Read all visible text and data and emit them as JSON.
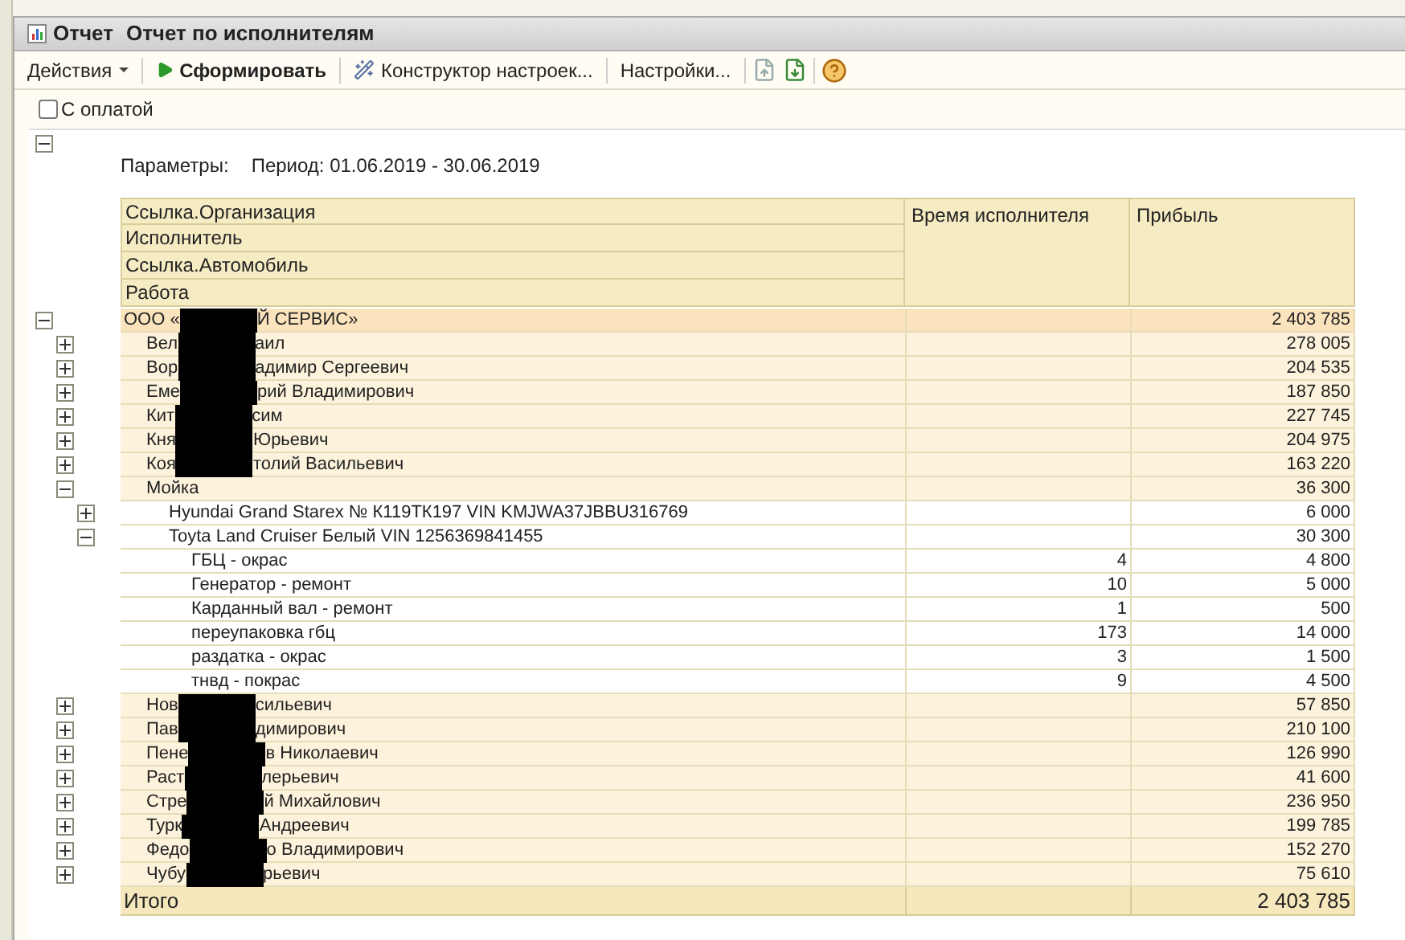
{
  "window": {
    "kind_label": "Отчет",
    "title": "Отчет по исполнителям"
  },
  "toolbar": {
    "actions_menu": "Действия",
    "generate": "Сформировать",
    "designer": "Конструктор настроек...",
    "settings": "Настройки..."
  },
  "filter": {
    "label": "С оплатой",
    "checked": false
  },
  "report": {
    "parameters_label": "Параметры:",
    "period": "Период: 01.06.2019 - 30.06.2019",
    "parameters_expanded": true,
    "header": {
      "groupings": [
        "Ссылка.Организация",
        "Исполнитель",
        "Ссылка.Автомобиль",
        "Работа"
      ],
      "time": "Время исполнителя",
      "profit": "Прибыль"
    },
    "rows": [
      {
        "text": "ООО «",
        "text_after": "Й СЕРВИС»",
        "time": "",
        "profit": "2 403 785",
        "expanded": true,
        "children": [
          {
            "text": "Вел",
            "text_after": "аил",
            "profit": "278 005",
            "expanded": false
          },
          {
            "text": "Вор",
            "text_after": "адимир Сергеевич",
            "profit": "204 535",
            "expanded": false
          },
          {
            "text": "Еме",
            "text_after": "рий Владимирович",
            "profit": "187 850",
            "expanded": false
          },
          {
            "text": "Кит",
            "text_after": "сим",
            "profit": "227 745",
            "expanded": false
          },
          {
            "text": "Кня",
            "text_after": "Юрьевич",
            "profit": "204 975",
            "expanded": false
          },
          {
            "text": "Коя",
            "text_after": "толий Васильевич",
            "profit": "163 220",
            "expanded": false
          },
          {
            "text": "Мойка",
            "profit": "36 300",
            "expanded": true,
            "children": [
              {
                "text": "Hyundai Grand Starex № К119ТК197 VIN KMJWA37JBBU316769",
                "profit": "6 000",
                "expanded": false
              },
              {
                "text": "Toyta Land Cruiser Белый VIN 1256369841455",
                "profit": "30 300",
                "expanded": true,
                "children": [
                  {
                    "text": "ГБЦ - окрас",
                    "time": "4",
                    "profit": "4 800"
                  },
                  {
                    "text": "Генератор - ремонт",
                    "time": "10",
                    "profit": "5 000"
                  },
                  {
                    "text": "Карданный вал - ремонт",
                    "time": "1",
                    "profit": "500"
                  },
                  {
                    "text": "переупаковка гбц",
                    "time": "173",
                    "profit": "14 000"
                  },
                  {
                    "text": "раздатка - окрас",
                    "time": "3",
                    "profit": "1 500"
                  },
                  {
                    "text": "тнвд - покрас",
                    "time": "9",
                    "profit": "4 500"
                  }
                ]
              }
            ]
          },
          {
            "text": "Нов",
            "text_after": "сильевич",
            "profit": "57 850",
            "expanded": false
          },
          {
            "text": "Пав",
            "text_after": "димирович",
            "profit": "210 100",
            "expanded": false
          },
          {
            "text": "Пене",
            "text_after": "в Николаевич",
            "profit": "126 990",
            "expanded": false
          },
          {
            "text": "Раст",
            "text_after": "лерьевич",
            "profit": "41 600",
            "expanded": false
          },
          {
            "text": "Стре",
            "text_after": "й Михайлович",
            "profit": "236 950",
            "expanded": false
          },
          {
            "text": "Турк",
            "text_after": "Андреевич",
            "profit": "199 785",
            "expanded": false
          },
          {
            "text": "Федо",
            "text_after": "о Владимирович",
            "profit": "152 270",
            "expanded": false
          },
          {
            "text": "Чубу",
            "text_after": "рьевич",
            "profit": "75 610",
            "expanded": false
          }
        ]
      }
    ],
    "total": {
      "label": "Итого",
      "profit": "2 403 785"
    }
  }
}
